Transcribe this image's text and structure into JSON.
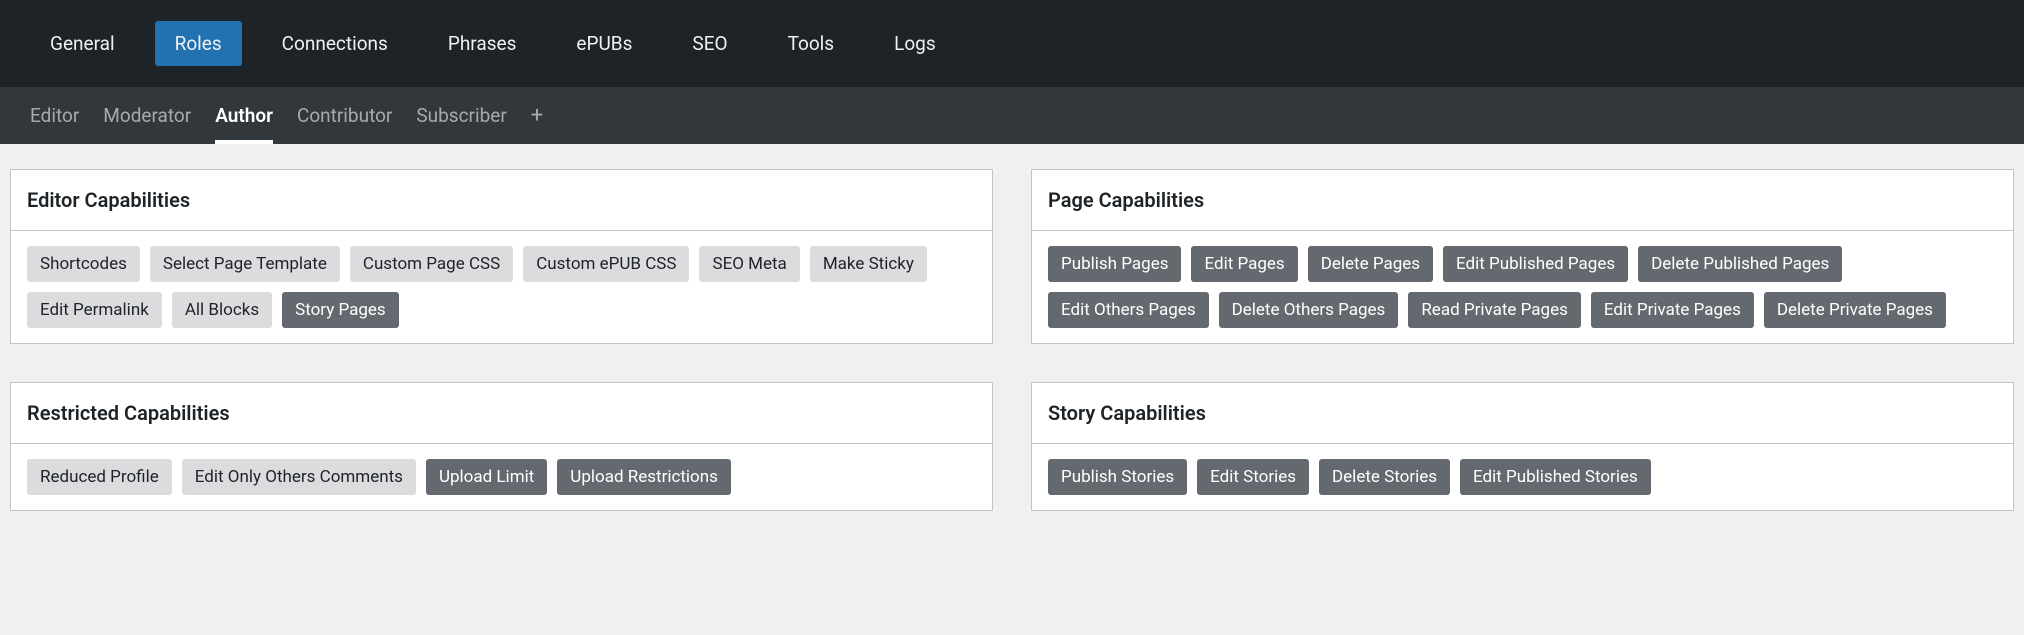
{
  "primaryNav": {
    "items": [
      {
        "label": "General",
        "name": "nav-general",
        "active": false
      },
      {
        "label": "Roles",
        "name": "nav-roles",
        "active": true
      },
      {
        "label": "Connections",
        "name": "nav-connections",
        "active": false
      },
      {
        "label": "Phrases",
        "name": "nav-phrases",
        "active": false
      },
      {
        "label": "ePUBs",
        "name": "nav-epubs",
        "active": false
      },
      {
        "label": "SEO",
        "name": "nav-seo",
        "active": false
      },
      {
        "label": "Tools",
        "name": "nav-tools",
        "active": false
      },
      {
        "label": "Logs",
        "name": "nav-logs",
        "active": false
      }
    ]
  },
  "secondaryNav": {
    "items": [
      {
        "label": "Editor",
        "name": "role-editor",
        "active": false
      },
      {
        "label": "Moderator",
        "name": "role-moderator",
        "active": false
      },
      {
        "label": "Author",
        "name": "role-author",
        "active": true
      },
      {
        "label": "Contributor",
        "name": "role-contributor",
        "active": false
      },
      {
        "label": "Subscriber",
        "name": "role-subscriber",
        "active": false
      }
    ]
  },
  "panels": {
    "left": [
      {
        "title": "Editor Capabilities",
        "name": "editor-capabilities-panel",
        "items": [
          {
            "label": "Shortcodes",
            "name": "cap-shortcodes",
            "active": false
          },
          {
            "label": "Select Page Template",
            "name": "cap-select-page-template",
            "active": false
          },
          {
            "label": "Custom Page CSS",
            "name": "cap-custom-page-css",
            "active": false
          },
          {
            "label": "Custom ePUB CSS",
            "name": "cap-custom-epub-css",
            "active": false
          },
          {
            "label": "SEO Meta",
            "name": "cap-seo-meta",
            "active": false
          },
          {
            "label": "Make Sticky",
            "name": "cap-make-sticky",
            "active": false
          },
          {
            "label": "Edit Permalink",
            "name": "cap-edit-permalink",
            "active": false
          },
          {
            "label": "All Blocks",
            "name": "cap-all-blocks",
            "active": false
          },
          {
            "label": "Story Pages",
            "name": "cap-story-pages",
            "active": true
          }
        ]
      },
      {
        "title": "Restricted Capabilities",
        "name": "restricted-capabilities-panel",
        "items": [
          {
            "label": "Reduced Profile",
            "name": "cap-reduced-profile",
            "active": false
          },
          {
            "label": "Edit Only Others Comments",
            "name": "cap-edit-only-others-comments",
            "active": false
          },
          {
            "label": "Upload Limit",
            "name": "cap-upload-limit",
            "active": true
          },
          {
            "label": "Upload Restrictions",
            "name": "cap-upload-restrictions",
            "active": true
          }
        ]
      }
    ],
    "right": [
      {
        "title": "Page Capabilities",
        "name": "page-capabilities-panel",
        "items": [
          {
            "label": "Publish Pages",
            "name": "cap-publish-pages",
            "active": true
          },
          {
            "label": "Edit Pages",
            "name": "cap-edit-pages",
            "active": true
          },
          {
            "label": "Delete Pages",
            "name": "cap-delete-pages",
            "active": true
          },
          {
            "label": "Edit Published Pages",
            "name": "cap-edit-published-pages",
            "active": true
          },
          {
            "label": "Delete Published Pages",
            "name": "cap-delete-published-pages",
            "active": true
          },
          {
            "label": "Edit Others Pages",
            "name": "cap-edit-others-pages",
            "active": true
          },
          {
            "label": "Delete Others Pages",
            "name": "cap-delete-others-pages",
            "active": true
          },
          {
            "label": "Read Private Pages",
            "name": "cap-read-private-pages",
            "active": true
          },
          {
            "label": "Edit Private Pages",
            "name": "cap-edit-private-pages",
            "active": true
          },
          {
            "label": "Delete Private Pages",
            "name": "cap-delete-private-pages",
            "active": true
          }
        ]
      },
      {
        "title": "Story Capabilities",
        "name": "story-capabilities-panel",
        "items": [
          {
            "label": "Publish Stories",
            "name": "cap-publish-stories",
            "active": true
          },
          {
            "label": "Edit Stories",
            "name": "cap-edit-stories",
            "active": true
          },
          {
            "label": "Delete Stories",
            "name": "cap-delete-stories",
            "active": true
          },
          {
            "label": "Edit Published Stories",
            "name": "cap-edit-published-stories",
            "active": true
          }
        ]
      }
    ]
  }
}
